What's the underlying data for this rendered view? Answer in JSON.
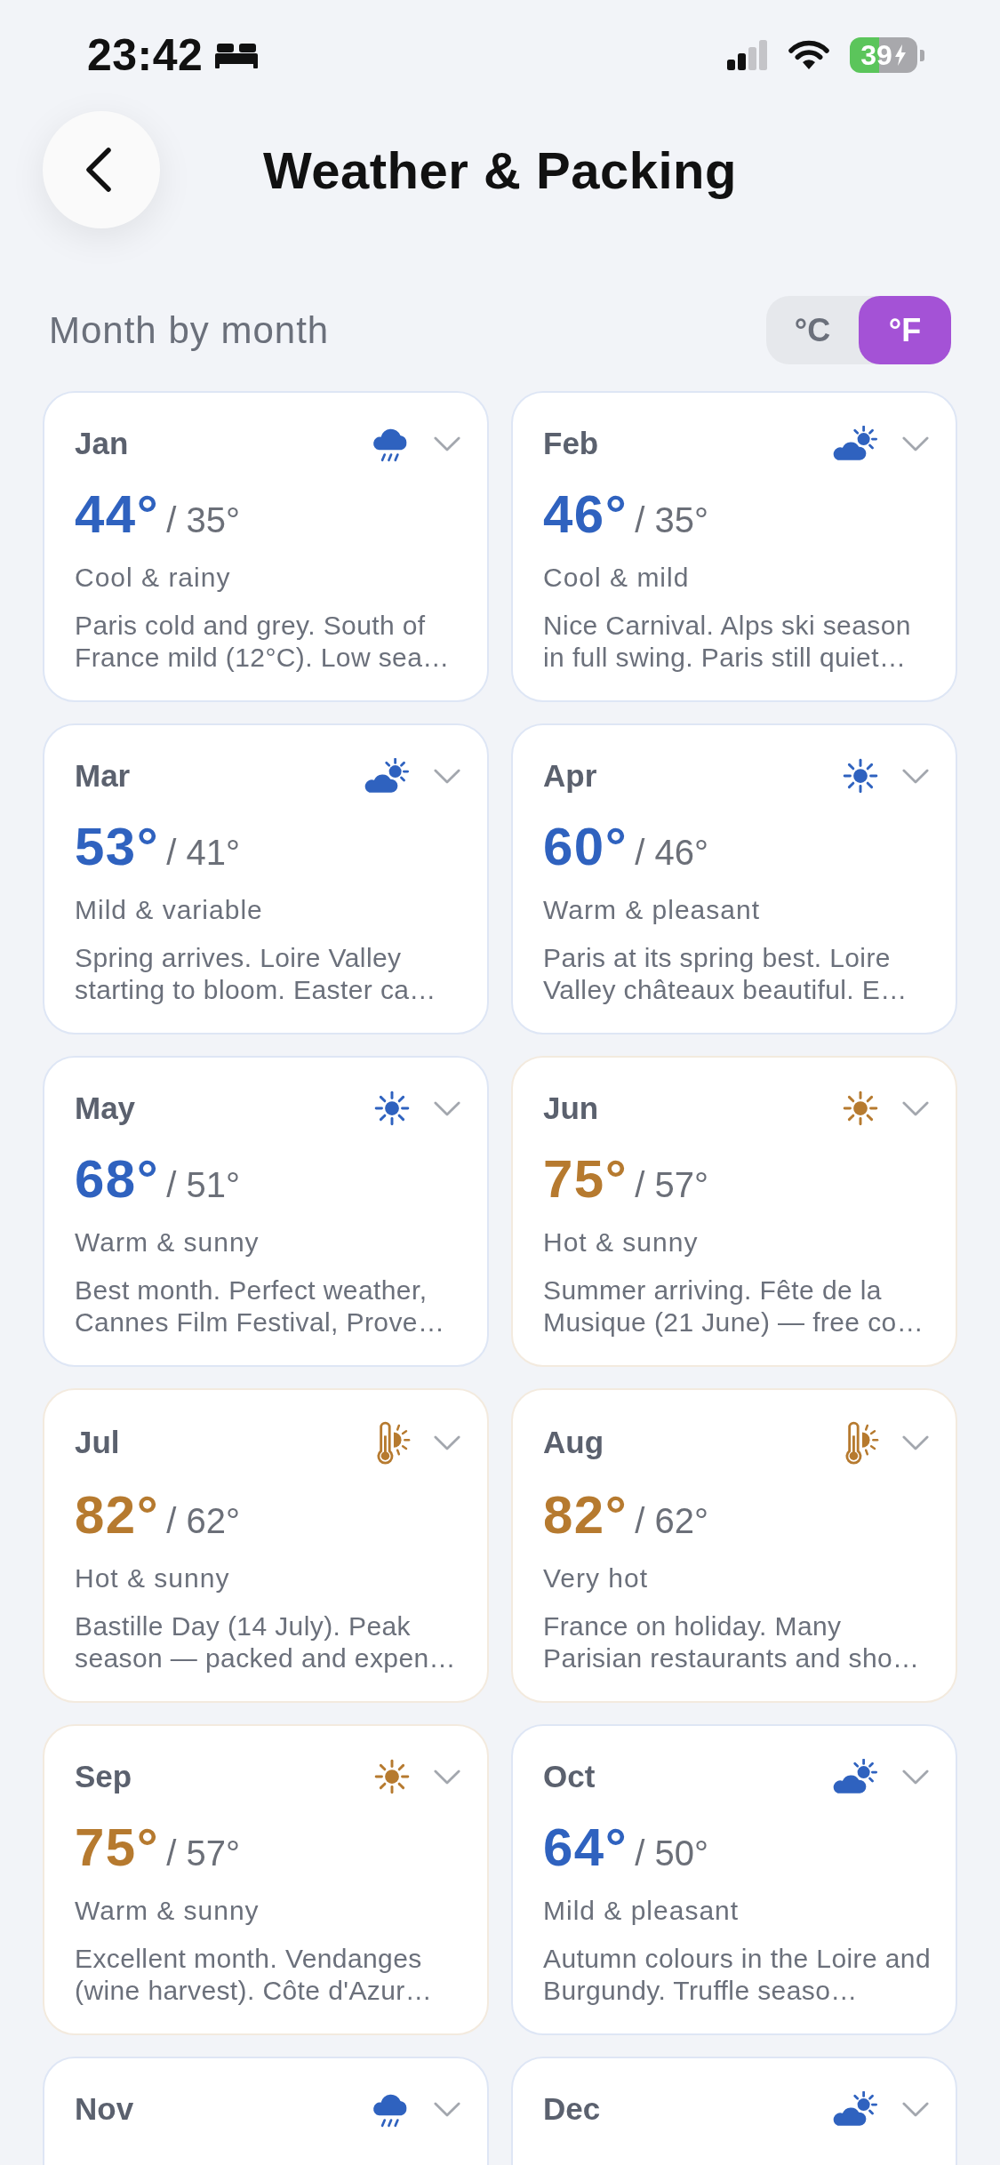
{
  "status_bar": {
    "time": "23:42",
    "battery": "39"
  },
  "header": {
    "title": "Weather & Packing"
  },
  "section": {
    "title": "Month by month",
    "units": [
      {
        "label": "°C",
        "selected": false
      },
      {
        "label": "°F",
        "selected": true
      }
    ]
  },
  "months": [
    {
      "name": "Jan",
      "kind": "rain",
      "color": "#2f62bf",
      "expanded": false,
      "high": "44°",
      "low": "/ 35°",
      "condition": "Cool & rainy",
      "description": "Paris cold and grey. South of France mild (12°C). Low sea…"
    },
    {
      "name": "Feb",
      "kind": "partly_cloudy",
      "color": "#2f62bf",
      "expanded": false,
      "high": "46°",
      "low": "/ 35°",
      "condition": "Cool & mild",
      "description": "Nice Carnival. Alps ski season in full swing. Paris still quiet…"
    },
    {
      "name": "Mar",
      "kind": "partly_cloudy",
      "color": "#2f62bf",
      "expanded": false,
      "high": "53°",
      "low": "/ 41°",
      "condition": "Mild & variable",
      "description": "Spring arrives. Loire Valley starting to bloom. Easter ca…"
    },
    {
      "name": "Apr",
      "kind": "sun",
      "color": "#2f62bf",
      "expanded": false,
      "high": "60°",
      "low": "/ 46°",
      "condition": "Warm & pleasant",
      "description": "Paris at its spring best. Loire Valley châteaux beautiful. E…"
    },
    {
      "name": "May",
      "kind": "sun",
      "color": "#2f62bf",
      "expanded": false,
      "high": "68°",
      "low": "/ 51°",
      "condition": "Warm & sunny",
      "description": "Best month. Perfect weather, Cannes Film Festival, Prove…"
    },
    {
      "name": "Jun",
      "kind": "sun",
      "color": "#b67a2f",
      "expanded": false,
      "high": "75°",
      "low": "/ 57°",
      "condition": "Hot & sunny",
      "description": "Summer arriving. Fête de la Musique (21 June) — free co…"
    },
    {
      "name": "Jul",
      "kind": "hot",
      "color": "#b67a2f",
      "expanded": false,
      "high": "82°",
      "low": "/ 62°",
      "condition": "Hot & sunny",
      "description": "Bastille Day (14 July). Peak season — packed and expen…"
    },
    {
      "name": "Aug",
      "kind": "hot",
      "color": "#b67a2f",
      "expanded": false,
      "high": "82°",
      "low": "/ 62°",
      "condition": "Very hot",
      "description": "France on holiday. Many Parisian restaurants and sho…"
    },
    {
      "name": "Sep",
      "kind": "sun",
      "color": "#b67a2f",
      "expanded": false,
      "high": "75°",
      "low": "/ 57°",
      "condition": "Warm & sunny",
      "description": "Excellent month. Vendanges (wine harvest). Côte d'Azur…"
    },
    {
      "name": "Oct",
      "kind": "partly_cloudy",
      "color": "#2f62bf",
      "expanded": false,
      "high": "64°",
      "low": "/ 50°",
      "condition": "Mild & pleasant",
      "description": "Autumn colours in the Loire and Burgundy. Truffle seaso…"
    },
    {
      "name": "Nov",
      "kind": "rain",
      "color": "#2f62bf",
      "expanded": false
    },
    {
      "name": "Dec",
      "kind": "partly_cloudy",
      "color": "#2f62bf",
      "expanded": false
    }
  ]
}
